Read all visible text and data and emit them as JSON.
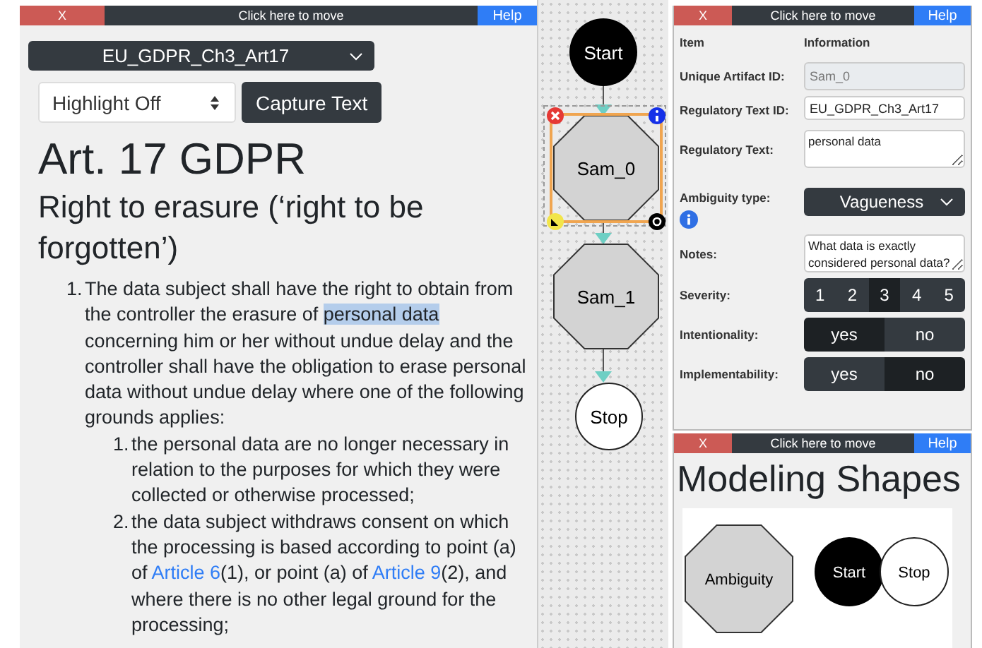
{
  "text_window": {
    "close": "X",
    "move": "Click here to move",
    "help": "Help",
    "document_select": "EU_GDPR_Ch3_Art17",
    "highlight_select": "Highlight Off",
    "capture_button": "Capture Text",
    "title": "Art. 17 GDPR",
    "subtitle": "Right to erasure (‘right to be forgotten’)",
    "items": [
      {
        "number": "1.",
        "segments": [
          {
            "kind": "text",
            "text": "The data subject shall have the right to obtain from the controller the erasure of "
          },
          {
            "kind": "highlight",
            "text": "personal data"
          },
          {
            "kind": "text",
            "text": " concerning him or her without undue delay and the controller shall have the obligation to erase personal data without undue delay where one of the following grounds applies:"
          }
        ],
        "children": [
          {
            "number": "1.",
            "segments": [
              {
                "kind": "text",
                "text": "the personal data are no longer necessary in relation to the purposes for which they were collected or otherwise processed;"
              }
            ]
          },
          {
            "number": "2.",
            "segments": [
              {
                "kind": "text",
                "text": "the data subject withdraws consent on which the processing is based according to point (a) of "
              },
              {
                "kind": "link",
                "text": "Article 6"
              },
              {
                "kind": "text",
                "text": "(1), or point (a) of "
              },
              {
                "kind": "link",
                "text": "Article 9"
              },
              {
                "kind": "text",
                "text": "(2), and where there is no other legal ground for the processing;"
              }
            ]
          }
        ]
      }
    ]
  },
  "diagram": {
    "nodes": [
      {
        "label": "Start",
        "kind": "start",
        "selected": false
      },
      {
        "label": "Sam_0",
        "kind": "ambiguity",
        "selected": true
      },
      {
        "label": "Sam_1",
        "kind": "ambiguity",
        "selected": false
      },
      {
        "label": "Stop",
        "kind": "stop",
        "selected": false
      }
    ]
  },
  "info_window": {
    "close": "X",
    "move": "Click here to move",
    "help": "Help",
    "header": [
      "Item",
      "Information"
    ],
    "rows": [
      {
        "kind": "readonly",
        "label": "Unique Artifact ID:",
        "value": "Sam_0"
      },
      {
        "kind": "input",
        "label": "Regulatory Text ID:",
        "value": "EU_GDPR_Ch3_Art17"
      },
      {
        "kind": "textarea",
        "label": "Regulatory Text:",
        "value": "personal data"
      },
      {
        "kind": "select",
        "label": "Ambiguity type:",
        "value": "Vagueness",
        "info": true
      },
      {
        "kind": "textarea",
        "label": "Notes:",
        "value": "What data is exactly considered personal data?"
      },
      {
        "kind": "segmented",
        "label": "Severity:",
        "options": [
          {
            "label": "1",
            "selected": false
          },
          {
            "label": "2",
            "selected": false
          },
          {
            "label": "3",
            "selected": true
          },
          {
            "label": "4",
            "selected": false
          },
          {
            "label": "5",
            "selected": false
          }
        ]
      },
      {
        "kind": "segmented",
        "label": "Intentionality:",
        "options": [
          {
            "label": "yes",
            "selected": true
          },
          {
            "label": "no",
            "selected": false
          }
        ]
      },
      {
        "kind": "segmented",
        "label": "Implementability:",
        "options": [
          {
            "label": "yes",
            "selected": false
          },
          {
            "label": "no",
            "selected": true
          }
        ]
      }
    ]
  },
  "shapes_window": {
    "close": "X",
    "move": "Click here to move",
    "help": "Help",
    "title": "Modeling Shapes",
    "shapes": [
      {
        "label": "Ambiguity",
        "kind": "ambiguity"
      },
      {
        "label": "Start",
        "kind": "start"
      },
      {
        "label": "Stop",
        "kind": "stop"
      }
    ]
  }
}
